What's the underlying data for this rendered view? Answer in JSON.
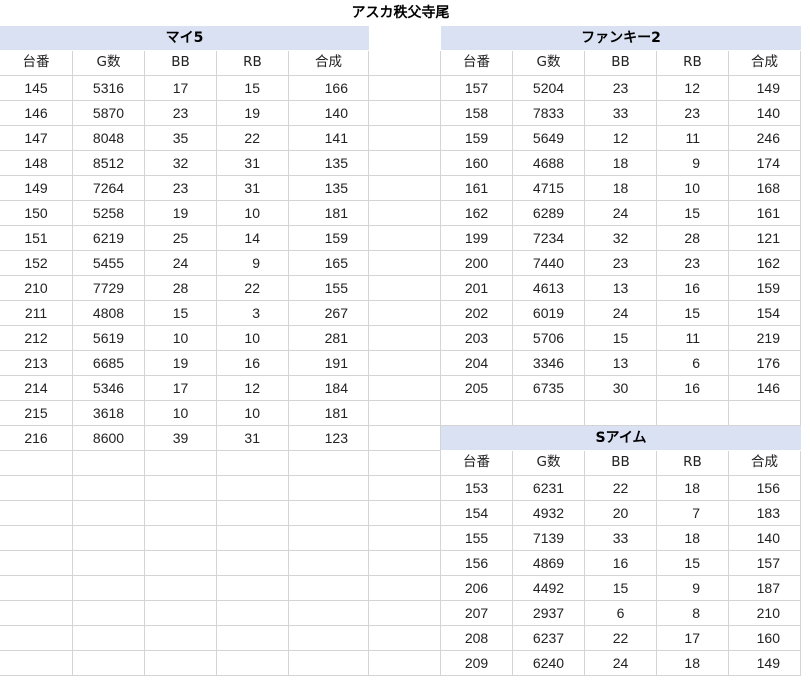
{
  "title": "アスカ秩父寺尾",
  "columns": [
    "台番",
    "G数",
    "BB",
    "RB",
    "合成"
  ],
  "colors": {
    "header_bg": "#d9e1f2",
    "grid": "#d4d4d4"
  },
  "tables": {
    "left": {
      "name": "マイ5",
      "rows": [
        [
          "145",
          "5316",
          "17",
          "15",
          "166"
        ],
        [
          "146",
          "5870",
          "23",
          "19",
          "140"
        ],
        [
          "147",
          "8048",
          "35",
          "22",
          "141"
        ],
        [
          "148",
          "8512",
          "32",
          "31",
          "135"
        ],
        [
          "149",
          "7264",
          "23",
          "31",
          "135"
        ],
        [
          "150",
          "5258",
          "19",
          "10",
          "181"
        ],
        [
          "151",
          "6219",
          "25",
          "14",
          "159"
        ],
        [
          "152",
          "5455",
          "24",
          "9",
          "165"
        ],
        [
          "210",
          "7729",
          "28",
          "22",
          "155"
        ],
        [
          "211",
          "4808",
          "15",
          "3",
          "267"
        ],
        [
          "212",
          "5619",
          "10",
          "10",
          "281"
        ],
        [
          "213",
          "6685",
          "19",
          "16",
          "191"
        ],
        [
          "214",
          "5346",
          "17",
          "12",
          "184"
        ],
        [
          "215",
          "3618",
          "10",
          "10",
          "181"
        ],
        [
          "216",
          "8600",
          "39",
          "31",
          "123"
        ]
      ]
    },
    "right_top": {
      "name": "ファンキー2",
      "rows": [
        [
          "157",
          "5204",
          "23",
          "12",
          "149"
        ],
        [
          "158",
          "7833",
          "33",
          "23",
          "140"
        ],
        [
          "159",
          "5649",
          "12",
          "11",
          "246"
        ],
        [
          "160",
          "4688",
          "18",
          "9",
          "174"
        ],
        [
          "161",
          "4715",
          "18",
          "10",
          "168"
        ],
        [
          "162",
          "6289",
          "24",
          "15",
          "161"
        ],
        [
          "199",
          "7234",
          "32",
          "28",
          "121"
        ],
        [
          "200",
          "7440",
          "23",
          "23",
          "162"
        ],
        [
          "201",
          "4613",
          "13",
          "16",
          "159"
        ],
        [
          "202",
          "6019",
          "24",
          "15",
          "154"
        ],
        [
          "203",
          "5706",
          "15",
          "11",
          "219"
        ],
        [
          "204",
          "3346",
          "13",
          "6",
          "176"
        ],
        [
          "205",
          "6735",
          "30",
          "16",
          "146"
        ]
      ]
    },
    "right_bottom": {
      "name": "Sアイム",
      "rows": [
        [
          "153",
          "6231",
          "22",
          "18",
          "156"
        ],
        [
          "154",
          "4932",
          "20",
          "7",
          "183"
        ],
        [
          "155",
          "7139",
          "33",
          "18",
          "140"
        ],
        [
          "156",
          "4869",
          "16",
          "15",
          "157"
        ],
        [
          "206",
          "4492",
          "15",
          "9",
          "187"
        ],
        [
          "207",
          "2937",
          "6",
          "8",
          "210"
        ],
        [
          "208",
          "6237",
          "22",
          "17",
          "160"
        ],
        [
          "209",
          "6240",
          "24",
          "18",
          "149"
        ]
      ]
    }
  }
}
